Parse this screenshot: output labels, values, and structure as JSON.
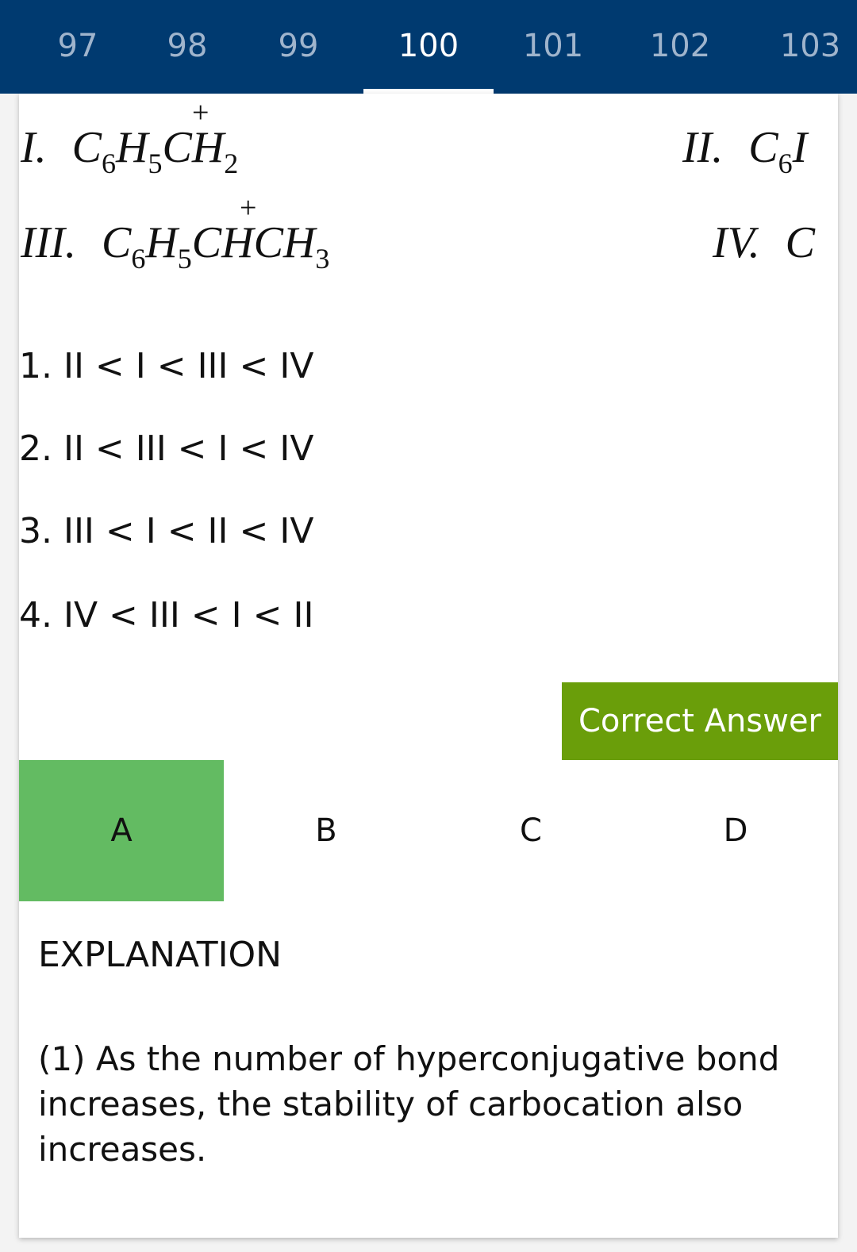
{
  "tabs": [
    "97",
    "98",
    "99",
    "100",
    "101",
    "102",
    "103"
  ],
  "active_tab": "100",
  "question": {
    "structures": {
      "s1": {
        "numeral": "I.",
        "formula_prefix": "C",
        "sub1": "6",
        "mid1": "H",
        "sub2": "5",
        "carbon": "C",
        "tail": "H",
        "sub3": "2",
        "charge": "+"
      },
      "s2": {
        "numeral": "II.",
        "partial": "C",
        "sub1": "6",
        "tail_partial": "I"
      },
      "s3": {
        "numeral": "III.",
        "formula_prefix": "C",
        "sub1": "6",
        "mid1": "H",
        "sub2": "5",
        "carbon": "C",
        "tail": "HCH",
        "sub3": "3",
        "charge": "+"
      },
      "s4": {
        "numeral": "IV.",
        "partial": "C"
      }
    },
    "options": [
      "1. II < I < III < IV",
      "2. II < III < I < IV",
      "3. III < I < II < IV",
      "4. IV < III < I < II"
    ]
  },
  "correct_answer_label": "Correct Answer",
  "answers": [
    "A",
    "B",
    "C",
    "D"
  ],
  "selected_answer": "A",
  "colors": {
    "header": "#003a70",
    "correct_button": "#6a9e0a",
    "selected_answer": "#63bb62"
  },
  "explanation": {
    "title": "EXPLANATION",
    "text": "(1) As the number of hyperconjugative bond increases, the stability of carbocation also increases."
  }
}
